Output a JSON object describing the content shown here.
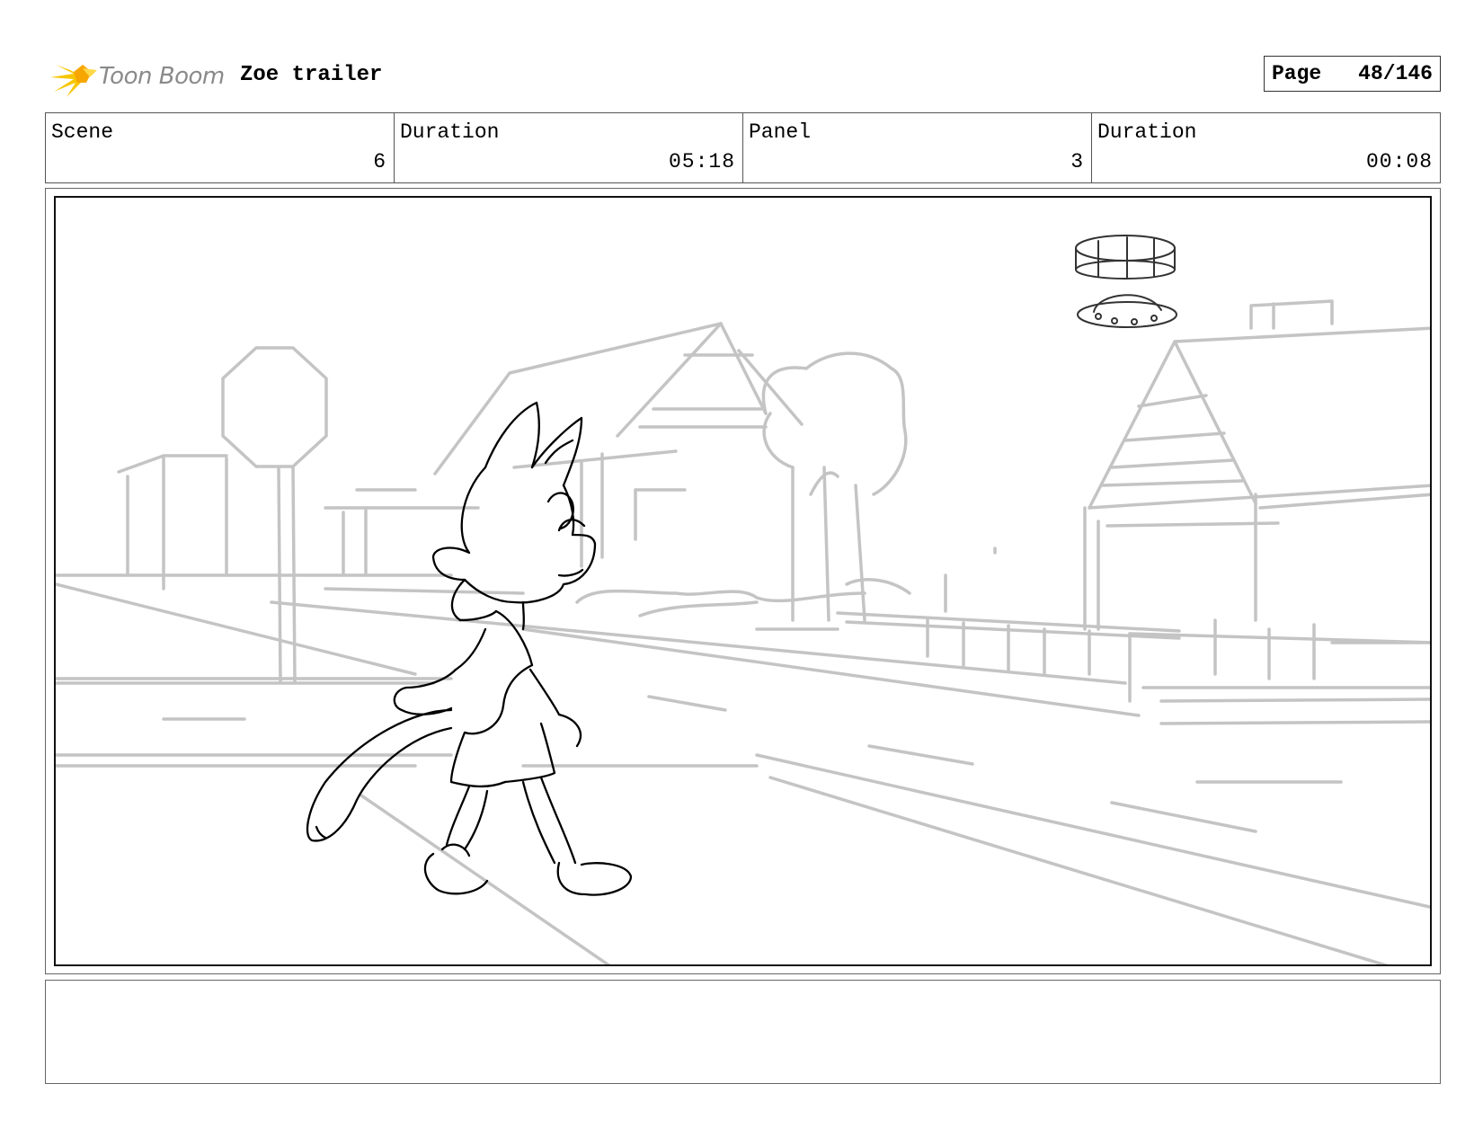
{
  "header": {
    "logo_text": "Toon Boom",
    "project_title": "Zoe trailer",
    "page_label": "Page",
    "page_number": "48/146"
  },
  "info": {
    "scene_label": "Scene",
    "scene_value": "6",
    "scene_duration_label": "Duration",
    "scene_duration_value": "05:18",
    "panel_label": "Panel",
    "panel_value": "3",
    "panel_duration_label": "Duration",
    "panel_duration_value": "00:08"
  },
  "notes": {
    "text": ""
  },
  "colors": {
    "background_sketch": "#c4c4c4",
    "character_ink": "#000000",
    "logo_accent": "#f5c400"
  }
}
